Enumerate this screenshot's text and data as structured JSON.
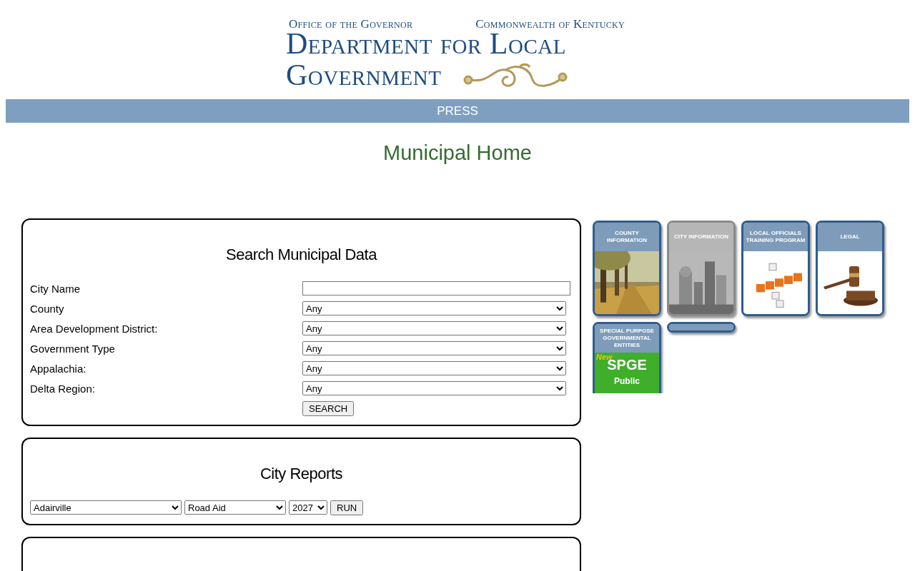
{
  "header": {
    "office": "Office of the Governor",
    "state": "Commonwealth of Kentucky",
    "title_line1": "Department for Local",
    "title_line2": "Government"
  },
  "nav": [
    {
      "label": "PRESS"
    }
  ],
  "page_title": "Municipal Home",
  "search": {
    "title": "Search Municipal Data",
    "fields": [
      {
        "label": "City Name",
        "kind": "text"
      },
      {
        "label": "County",
        "kind": "select",
        "value": "Any"
      },
      {
        "label": "Area Development District:",
        "kind": "select",
        "value": "Any"
      },
      {
        "label": "Government Type",
        "kind": "select",
        "value": "Any"
      },
      {
        "label": "Appalachia:",
        "kind": "select",
        "value": "Any"
      },
      {
        "label": "Delta Region:",
        "kind": "select",
        "value": "Any"
      }
    ],
    "button": "SEARCH"
  },
  "city_reports": {
    "title": "City Reports",
    "city": "Adairville",
    "report": "Road Aid",
    "year": "2027",
    "button": "RUN"
  },
  "tiles": [
    {
      "kind": "picture",
      "label": "COUNTY INFORMATION",
      "color": "#2f5d8f"
    },
    {
      "kind": "picture",
      "label": "CITY INFORMATION",
      "color": "#8a8a8a"
    },
    {
      "kind": "picture",
      "label": "LOCAL OFFICIALS TRAINING PROGRAM",
      "color": "#2f5d8f"
    },
    {
      "kind": "picture",
      "label": "LEGAL",
      "color": "#2f5d8f"
    },
    {
      "kind": "promo",
      "label": "SPECIAL PURPOSE GOVERNMENTAL ENTITIES",
      "color": "#2f5d8f",
      "badge": "New",
      "headline": "SPGE",
      "subline": "Public"
    },
    {
      "kind": "cut",
      "color": "#2f5d8f"
    }
  ]
}
